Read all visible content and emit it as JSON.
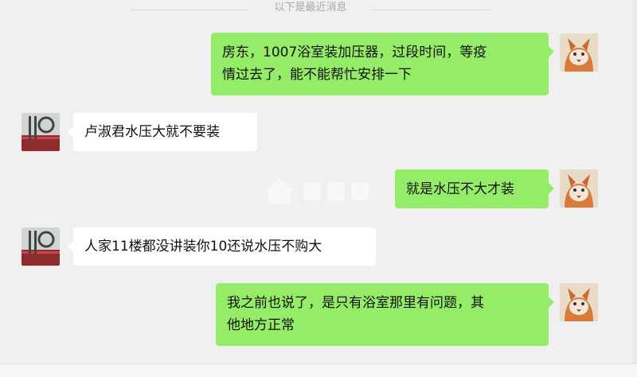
{
  "divider": {
    "label": "以下是最近消息"
  },
  "messages": [
    {
      "sender": "me",
      "text_lines": [
        "房东，1007浴室装加压器，过段时间，等疫",
        "情过去了，能不能帮忙安排一下"
      ]
    },
    {
      "sender": "other",
      "text_lines": [
        "卢淑君水压大就不要装"
      ]
    },
    {
      "sender": "me",
      "text_lines": [
        "就是水压不大才装"
      ]
    },
    {
      "sender": "other",
      "text_lines": [
        "人家11楼都没讲装你10还说水压不购大"
      ]
    },
    {
      "sender": "me",
      "text_lines": [
        "我之前也说了，是只有浴室那里有问题，其",
        "他地方正常"
      ]
    }
  ],
  "colors": {
    "background": "#f0f0f0",
    "my_bubble": "#95ec69",
    "other_bubble": "#ffffff",
    "divider_text": "#a8a8a8"
  },
  "icons": {
    "my_avatar": "cat-avatar-icon",
    "other_avatar": "rail-avatar-icon",
    "watermark": "house-watermark-icon"
  }
}
